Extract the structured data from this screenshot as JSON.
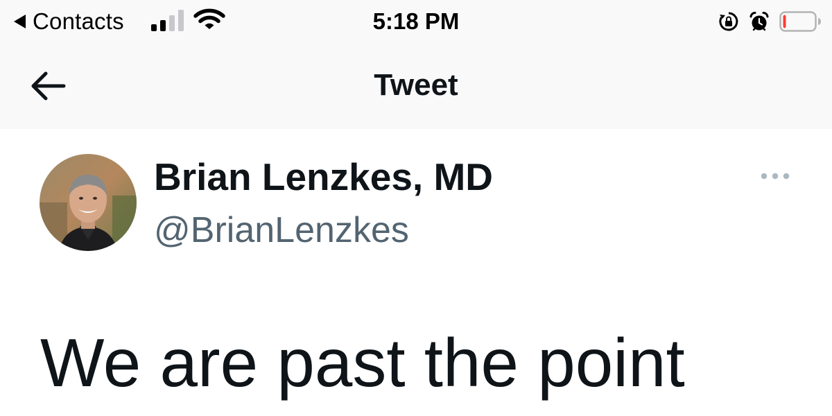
{
  "status_bar": {
    "back_app_label": "Contacts",
    "time": "5:18 PM",
    "signal_icon": "cellular-signal-icon",
    "wifi_icon": "wifi-icon",
    "orientation_lock_icon": "orientation-lock-icon",
    "alarm_icon": "alarm-icon",
    "battery_icon": "battery-low-icon",
    "signal_bars_filled": 2,
    "signal_bars_total": 4,
    "battery_level": 0.08
  },
  "nav": {
    "back_icon": "arrow-left-icon",
    "title": "Tweet"
  },
  "tweet": {
    "author_name": "Brian Lenzkes, MD",
    "author_handle": "@BrianLenzkes",
    "more_icon": "more-dots-icon",
    "text": "We are past the point"
  },
  "colors": {
    "text_primary": "#0f1419",
    "text_secondary": "#536471",
    "chrome_background": "#f9f9f9",
    "battery_low": "#ff3b30",
    "more_dots": "#aab8c2"
  }
}
